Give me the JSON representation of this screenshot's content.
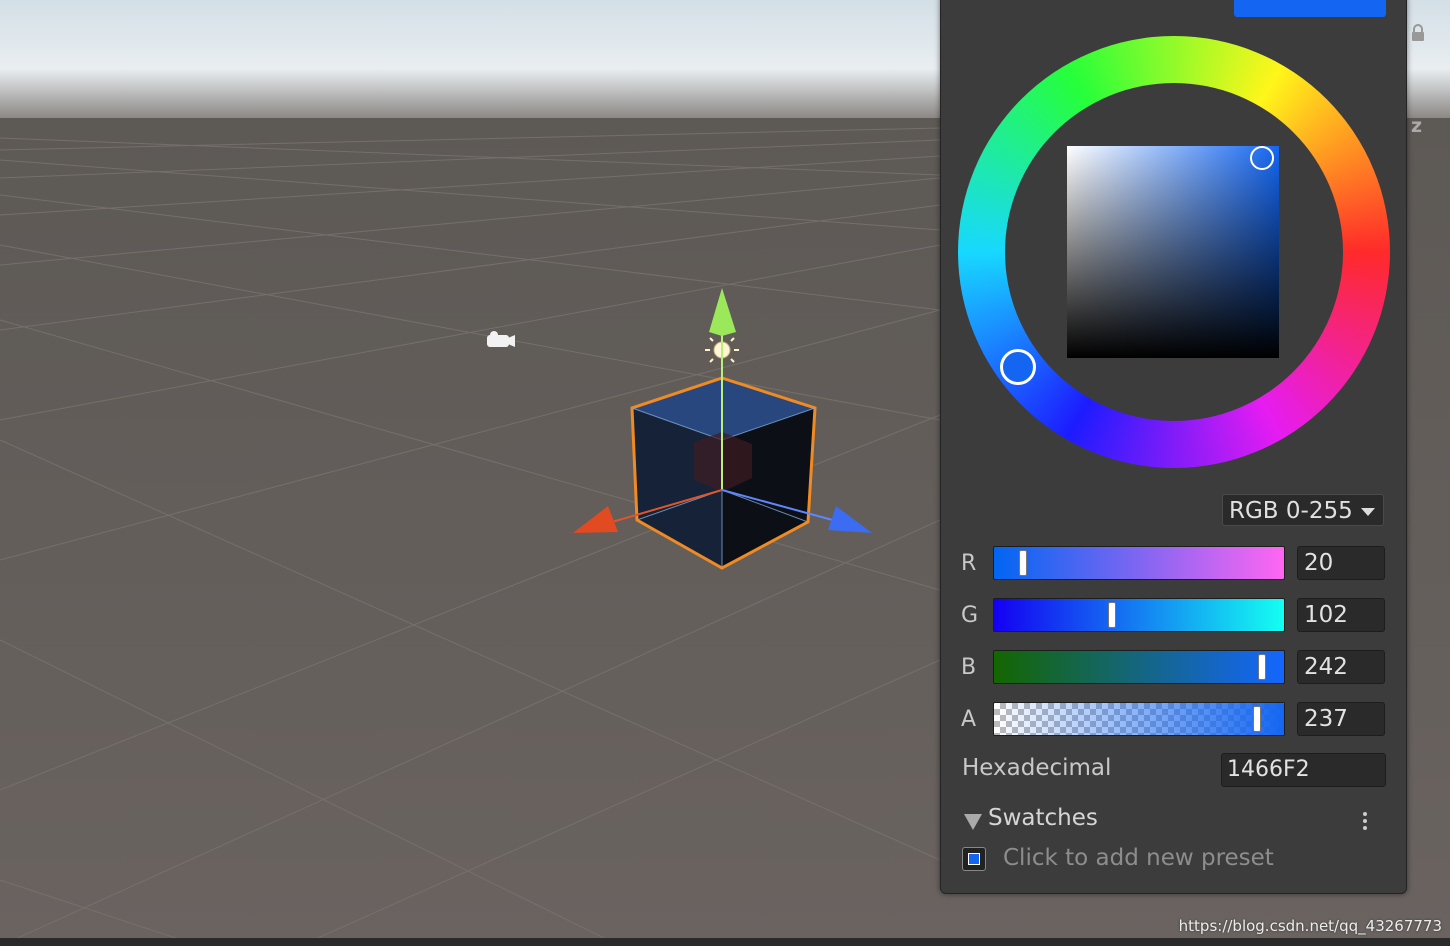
{
  "color_picker": {
    "color_mode": "RGB 0-255",
    "channels": [
      {
        "label": "R",
        "value": "20",
        "level": 0.078
      },
      {
        "label": "G",
        "value": "102",
        "level": 0.4
      },
      {
        "label": "B",
        "value": "242",
        "level": 0.949
      },
      {
        "label": "A",
        "value": "237",
        "level": 0.929
      }
    ],
    "hex_label": "Hexadecimal",
    "hex_value": "1466F2",
    "swatches_title": "Swatches",
    "add_preset_text": "Click to add new preset",
    "current_color": "#1466F2"
  },
  "scene_view": {
    "axis_label": "z",
    "icons": [
      "camera-icon",
      "light-icon",
      "lock-icon"
    ]
  },
  "watermark": "https://blog.csdn.net/qq_43267773"
}
